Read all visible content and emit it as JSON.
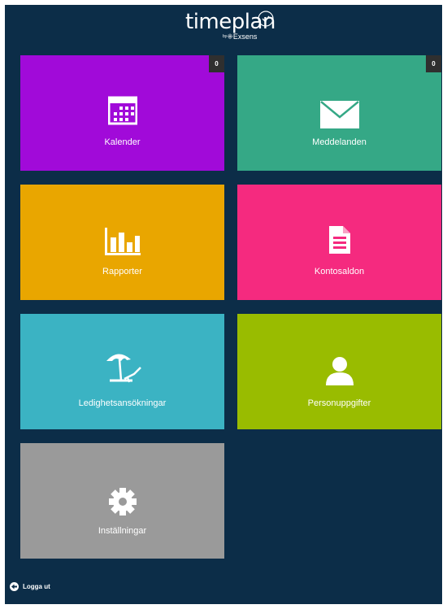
{
  "app": {
    "logo_text": "timeplan",
    "logo_by": "by",
    "logo_sub": "Exsens",
    "background": "#0c2d48"
  },
  "tiles": [
    {
      "label": "Kalender",
      "icon": "calendar-icon",
      "color": "#a10ad9",
      "badge": "0"
    },
    {
      "label": "Meddelanden",
      "icon": "envelope-icon",
      "color": "#35a886",
      "badge": "0"
    },
    {
      "label": "Rapporter",
      "icon": "bar-chart-icon",
      "color": "#e9a600"
    },
    {
      "label": "Kontosaldon",
      "icon": "document-icon",
      "color": "#f52a7f"
    },
    {
      "label": "Ledighetsansökningar",
      "icon": "beach-umbrella-icon",
      "color": "#3bb3c3"
    },
    {
      "label": "Personuppgifter",
      "icon": "person-icon",
      "color": "#99bc00"
    },
    {
      "label": "Inställningar",
      "icon": "gear-icon",
      "color": "#9a9a9a"
    }
  ],
  "footer": {
    "logout_label": "Logga ut",
    "logout_icon": "arrow-left-icon"
  }
}
